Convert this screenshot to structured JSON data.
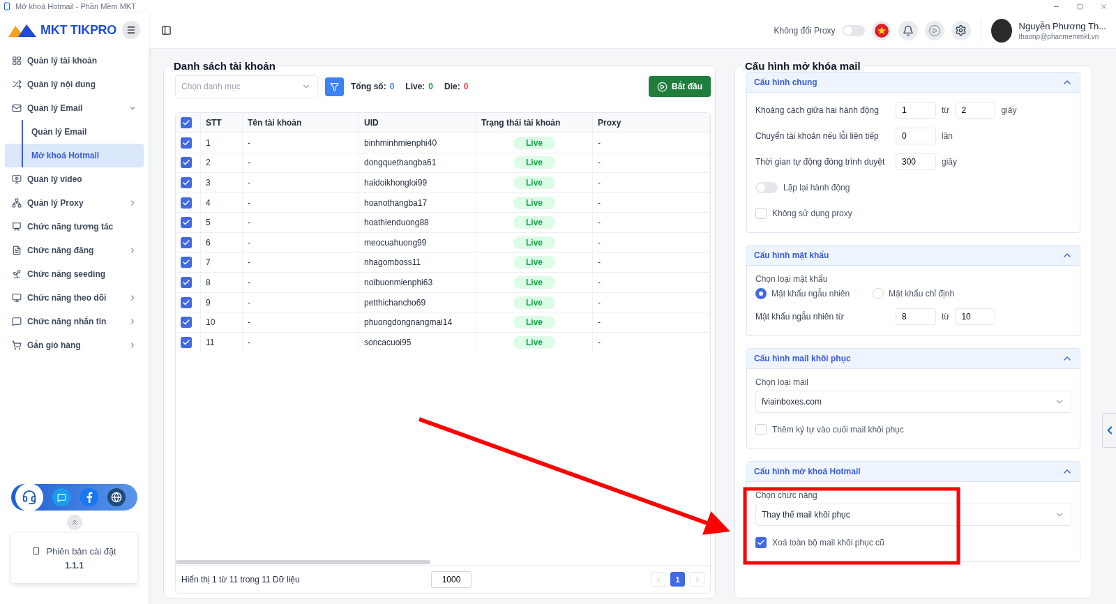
{
  "window": {
    "title": "Mở khoá Hotmail - Phần Mềm MKT"
  },
  "brand": {
    "name": "MKT TIKPRO"
  },
  "sidebar": {
    "items": [
      {
        "label": "Quản lý tài khoản",
        "kind": "link",
        "selected": false
      },
      {
        "label": "Quản lý nội dung",
        "kind": "link",
        "selected": false
      },
      {
        "label": "Quản lý Email",
        "kind": "group",
        "expanded": true,
        "selected": false,
        "children": [
          {
            "label": "Quản lý Email",
            "selected": false
          },
          {
            "label": "Mở khoá Hotmail",
            "selected": true
          }
        ]
      },
      {
        "label": "Quản lý video",
        "kind": "link",
        "selected": false
      },
      {
        "label": "Quản lý Proxy",
        "kind": "group",
        "expanded": false,
        "selected": false
      },
      {
        "label": "Chức năng tương tác",
        "kind": "link",
        "selected": false
      },
      {
        "label": "Chức năng đăng",
        "kind": "group",
        "expanded": false,
        "selected": false
      },
      {
        "label": "Chức năng seeding",
        "kind": "link",
        "selected": false
      },
      {
        "label": "Chức năng theo dõi",
        "kind": "group",
        "expanded": false,
        "selected": false
      },
      {
        "label": "Chức năng nhắn tin",
        "kind": "group",
        "expanded": false,
        "selected": false
      },
      {
        "label": "Gắn giỏ hàng",
        "kind": "group",
        "expanded": false,
        "selected": false
      }
    ]
  },
  "version": {
    "label": "Phiên bản cài đặt",
    "number": "1.1.1"
  },
  "header": {
    "proxy_toggle": {
      "label": "Không đổi Proxy",
      "on": false
    },
    "user": {
      "name": "Nguyễn Phương Th...",
      "email": "thaonp@phanmemmkt.vn"
    }
  },
  "accounts": {
    "title": "Danh sách tài khoản",
    "category": {
      "placeholder": "Chọn danh mục"
    },
    "stats": [
      {
        "label": "Tổng số:",
        "value": "0",
        "color": "#3b82f6"
      },
      {
        "label": "Live:",
        "value": "0",
        "color": "#16a34a"
      },
      {
        "label": "Die:",
        "value": "0",
        "color": "#ef4444"
      }
    ],
    "start_button": "Bắt đầu",
    "table": {
      "all_checked": true,
      "columns": [
        "STT",
        "Tên tài khoản",
        "UID",
        "Trạng thái tài khoản",
        "Proxy"
      ],
      "rows": [
        {
          "checked": true,
          "stt": "1",
          "name": "-",
          "uid": "binhminhmienphi40",
          "status": "Live",
          "proxy": "-"
        },
        {
          "checked": true,
          "stt": "2",
          "name": "-",
          "uid": "dongquethangba61",
          "status": "Live",
          "proxy": "-"
        },
        {
          "checked": true,
          "stt": "3",
          "name": "-",
          "uid": "haidoikhongloi99",
          "status": "Live",
          "proxy": "-"
        },
        {
          "checked": true,
          "stt": "4",
          "name": "-",
          "uid": "hoanothangba17",
          "status": "Live",
          "proxy": "-"
        },
        {
          "checked": true,
          "stt": "5",
          "name": "-",
          "uid": "hoathienduong88",
          "status": "Live",
          "proxy": "-"
        },
        {
          "checked": true,
          "stt": "6",
          "name": "-",
          "uid": "meocuahuong99",
          "status": "Live",
          "proxy": "-"
        },
        {
          "checked": true,
          "stt": "7",
          "name": "-",
          "uid": "nhagomboss11",
          "status": "Live",
          "proxy": "-"
        },
        {
          "checked": true,
          "stt": "8",
          "name": "-",
          "uid": "noibuonmienphi63",
          "status": "Live",
          "proxy": "-"
        },
        {
          "checked": true,
          "stt": "9",
          "name": "-",
          "uid": "petthichancho69",
          "status": "Live",
          "proxy": "-"
        },
        {
          "checked": true,
          "stt": "10",
          "name": "-",
          "uid": "phuongdongnangmai14",
          "status": "Live",
          "proxy": "-"
        },
        {
          "checked": true,
          "stt": "11",
          "name": "-",
          "uid": "soncacuoi95",
          "status": "Live",
          "proxy": "-"
        }
      ]
    },
    "footer": {
      "summary": "Hiển thị 1 từ 11 trong 11 Dữ liệu",
      "page_size": "1000",
      "pages": [
        {
          "label": "1",
          "selected": true
        }
      ]
    }
  },
  "config": {
    "title": "Cấu hình mở khóa mail",
    "sections": [
      {
        "title": "Cấu hình chung",
        "expanded": true,
        "fields": [
          {
            "kind": "range",
            "label": "Khoảng cách giữa hai hành động",
            "value": "1",
            "joiner": "từ",
            "value2": "2",
            "unit": "giây"
          },
          {
            "kind": "number",
            "label": "Chuyển tài khoản nếu lỗi liên tiếp",
            "value": "0",
            "unit": "lần"
          },
          {
            "kind": "number",
            "label": "Thời gian tự động đóng trình duyệt",
            "value": "300",
            "unit": "giây"
          },
          {
            "kind": "toggle",
            "label": "Lặp lại hành động",
            "on": false
          },
          {
            "kind": "checkbox",
            "label": "Không sử dụng proxy",
            "checked": false
          }
        ]
      },
      {
        "title": "Cấu hình mật khẩu",
        "expanded": true,
        "fields": [
          {
            "kind": "radio",
            "label": "Chọn loại mật khẩu",
            "options": [
              {
                "label": "Mật khẩu ngẫu nhiên",
                "selected": true
              },
              {
                "label": "Mật khẩu chỉ định",
                "selected": false
              }
            ]
          },
          {
            "kind": "range",
            "label": "Mật khẩu ngẫu nhiên từ",
            "value": "8",
            "joiner": "từ",
            "value2": "10"
          }
        ]
      },
      {
        "title": "Cấu hình mail khôi phục",
        "expanded": true,
        "fields": [
          {
            "kind": "select",
            "label": "Chọn loại mail",
            "value": "fviainboxes.com"
          },
          {
            "kind": "checkbox",
            "label": "Thêm ký tự vào cuối mail khôi phục",
            "checked": false
          }
        ]
      },
      {
        "title": "Cấu hình mở khoá Hotmail",
        "expanded": true,
        "fields": [
          {
            "kind": "select",
            "label": "Chọn chức năng",
            "value": "Thay thế mail khôi phục"
          },
          {
            "kind": "checkbox",
            "label": "Xoá toàn bộ mail khôi phục cũ",
            "checked": true
          }
        ]
      }
    ]
  }
}
